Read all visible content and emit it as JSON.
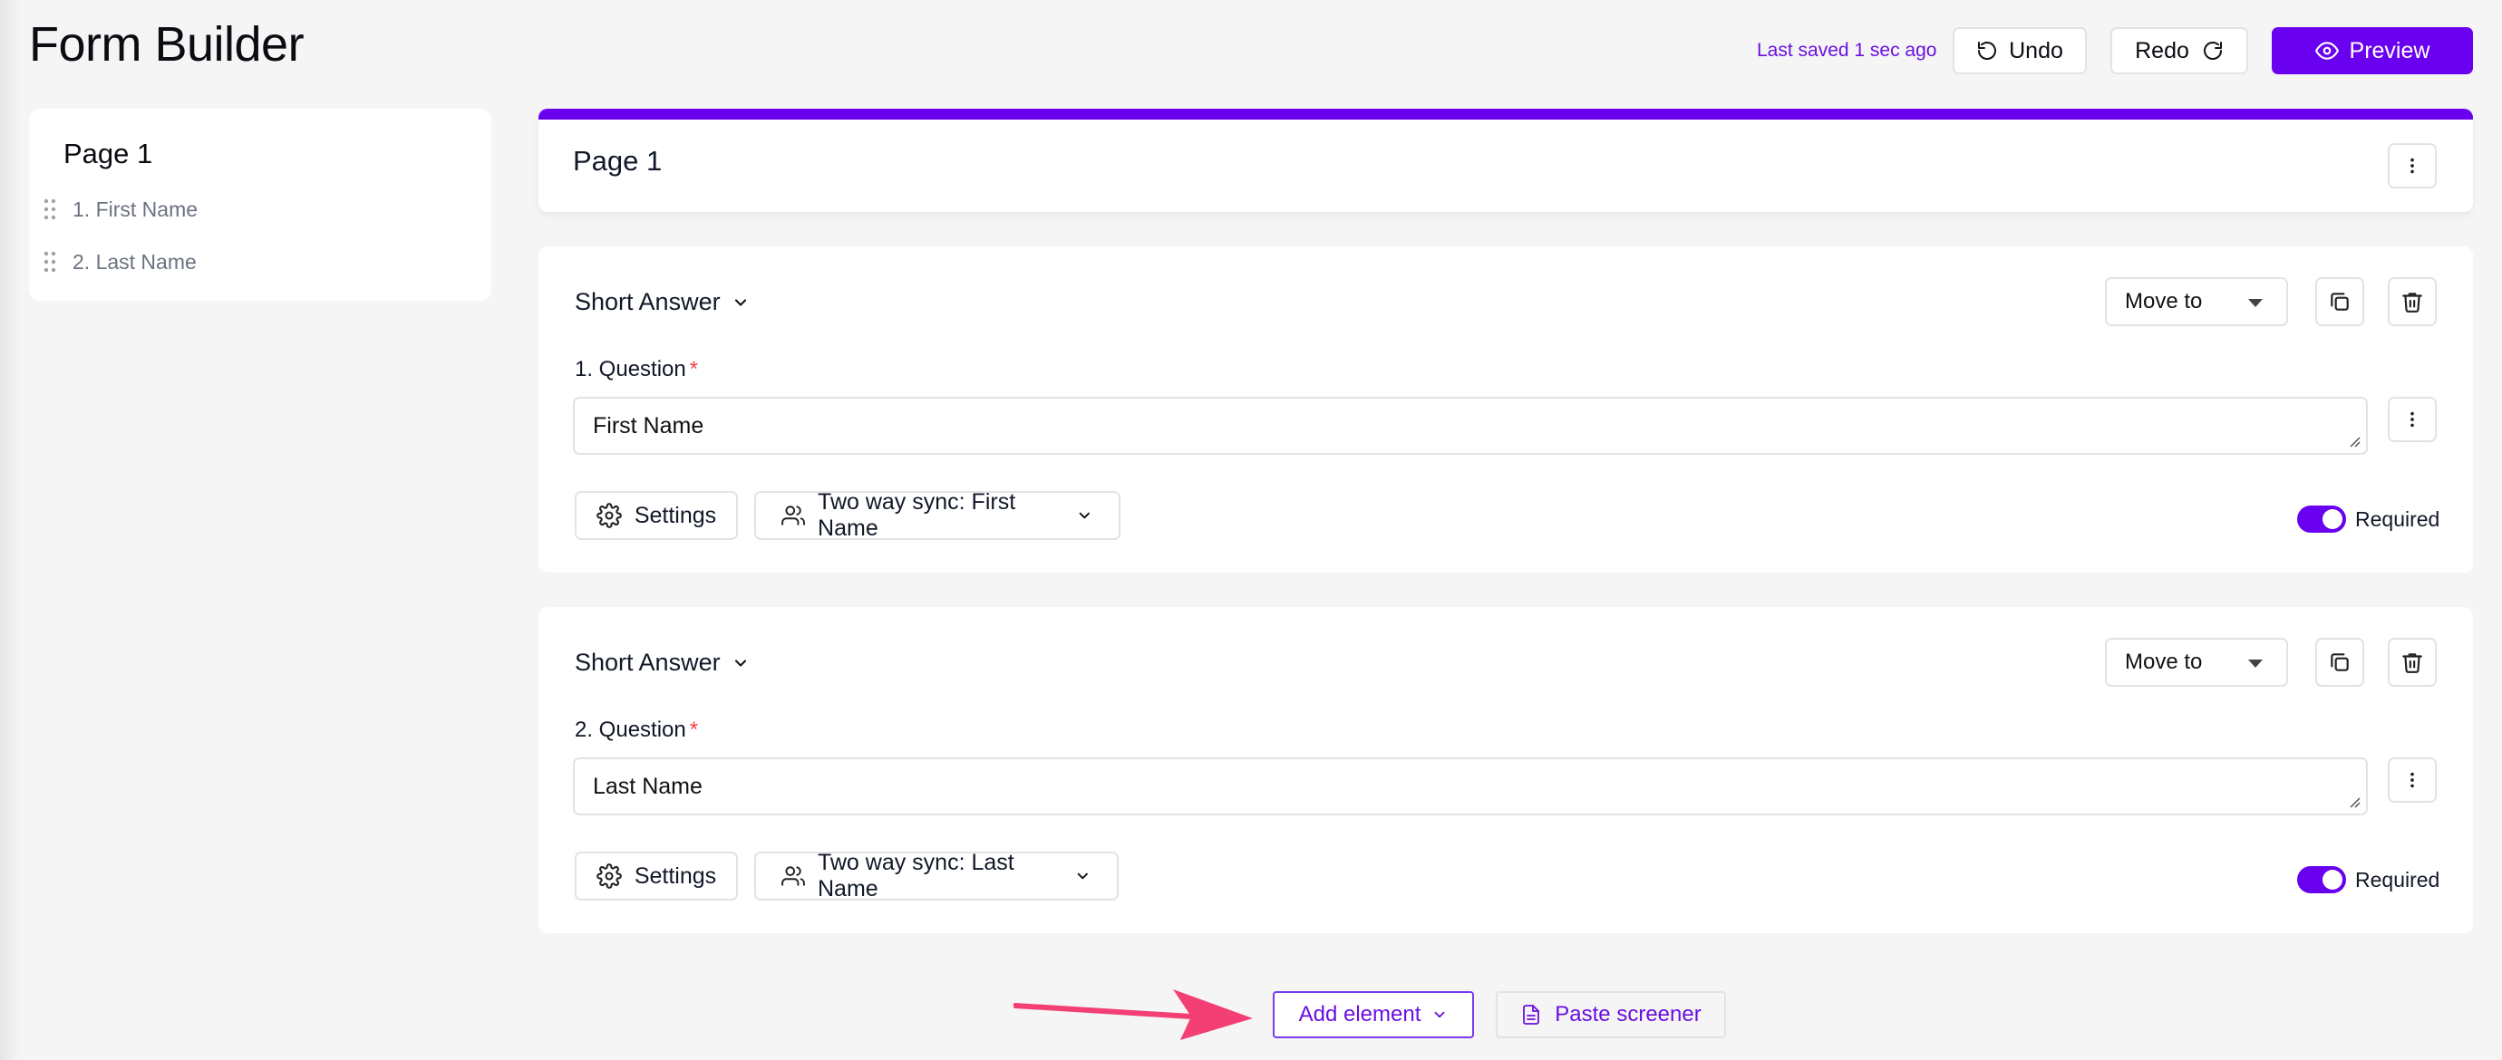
{
  "header": {
    "title": "Form Builder",
    "saved_status": "Last saved 1 sec ago",
    "undo_label": "Undo",
    "redo_label": "Redo",
    "preview_label": "Preview"
  },
  "sidebar": {
    "page_title": "Page 1",
    "items": [
      {
        "label": "1. First Name"
      },
      {
        "label": "2. Last Name"
      }
    ]
  },
  "page": {
    "title": "Page 1"
  },
  "questions": [
    {
      "type_label": "Short Answer",
      "move_to": "Move to",
      "label": "1. Question",
      "required_mark": "*",
      "value": "First Name",
      "settings_label": "Settings",
      "sync_label": "Two way sync: First Name",
      "required_label": "Required",
      "required": true
    },
    {
      "type_label": "Short Answer",
      "move_to": "Move to",
      "label": "2. Question",
      "required_mark": "*",
      "value": "Last Name",
      "settings_label": "Settings",
      "sync_label": "Two way sync: Last Name",
      "required_label": "Required",
      "required": true
    }
  ],
  "footer": {
    "add_element_label": "Add element",
    "paste_screener_label": "Paste screener"
  },
  "colors": {
    "accent": "#6a00f0",
    "required_star": "#ef4444",
    "annotation_arrow": "#f43f75"
  }
}
